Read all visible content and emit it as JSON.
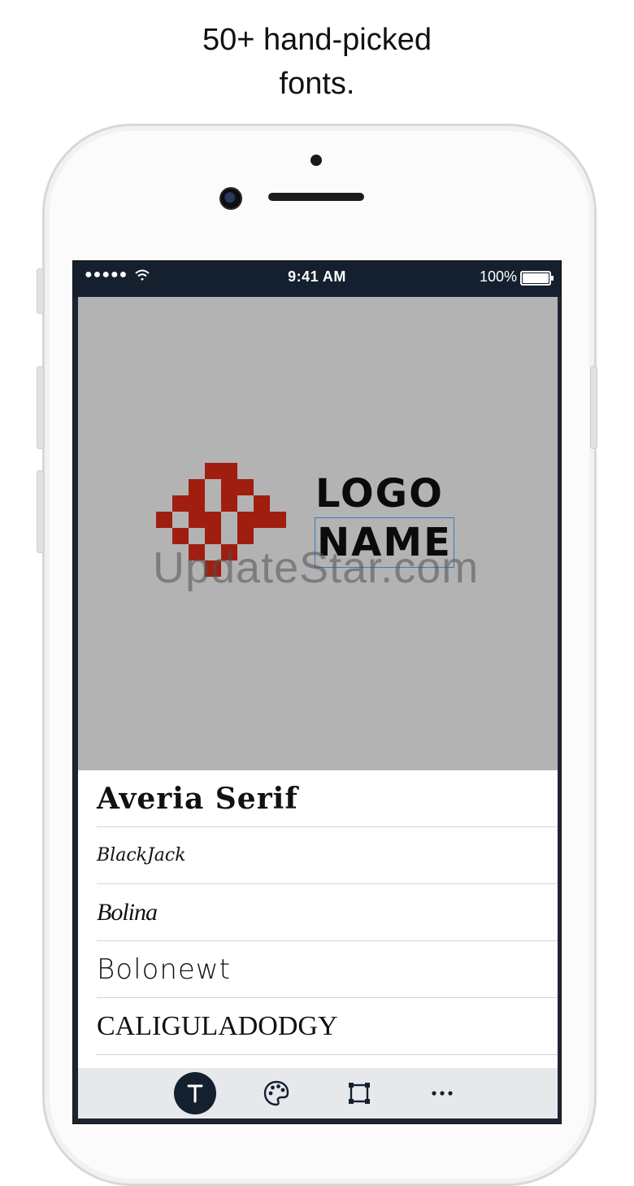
{
  "headline": {
    "line1": "50+ hand-picked",
    "line2": "fonts."
  },
  "statusbar": {
    "signal": "●●●●●",
    "time": "9:41 AM",
    "battery_pct": "100%"
  },
  "canvas": {
    "logo_line1": "LOGO",
    "logo_line2": "NAME",
    "watermark": "UpdateStar.com",
    "logo_color": "#a01e10",
    "background": "#b3b3b3"
  },
  "font_list": {
    "items": [
      {
        "label": "Averia Serif"
      },
      {
        "label": "BlackJack"
      },
      {
        "label": "Bolina"
      },
      {
        "label": "Bolonewt"
      },
      {
        "label": "CALIGULADODGY"
      }
    ]
  },
  "toolbar": {
    "items": [
      {
        "icon": "text-icon",
        "active": true
      },
      {
        "icon": "palette-icon",
        "active": false
      },
      {
        "icon": "crop-frame-icon",
        "active": false
      },
      {
        "icon": "more-icon",
        "active": false
      }
    ]
  }
}
